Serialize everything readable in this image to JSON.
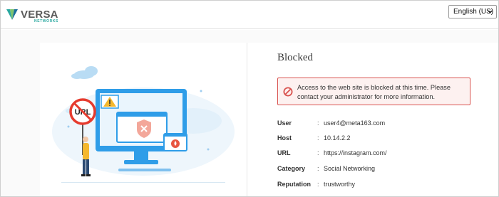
{
  "header": {
    "brand_name": "VERSA",
    "brand_sub": "NETWORKS",
    "language": {
      "selected": "English (US)",
      "icon": "chevron-down-icon"
    }
  },
  "page": {
    "title": "Blocked",
    "alert": {
      "icon": "blocked-circle-icon",
      "message": "Access to the web site is blocked at this time. Please contact your administrator for more information."
    },
    "details": [
      {
        "label": "User",
        "value": "user4@meta163.com"
      },
      {
        "label": "Host",
        "value": "10.14.2.2"
      },
      {
        "label": "URL",
        "value": "https://instagram.com/"
      },
      {
        "label": "Category",
        "value": "Social Networking"
      },
      {
        "label": "Reputation",
        "value": "trustworthy"
      }
    ],
    "separator": ":"
  },
  "illustration": {
    "sign_text": "URL",
    "warning_icon": "warning-triangle-icon",
    "blocked_window_icon": "shield-x-icon",
    "security_badge_icon": "security-drop-icon"
  },
  "colors": {
    "accent_blue": "#2f9de8",
    "light_blue": "#cfe8f8",
    "danger_red": "#d9534f",
    "brand_teal": "#2aa8a0"
  }
}
